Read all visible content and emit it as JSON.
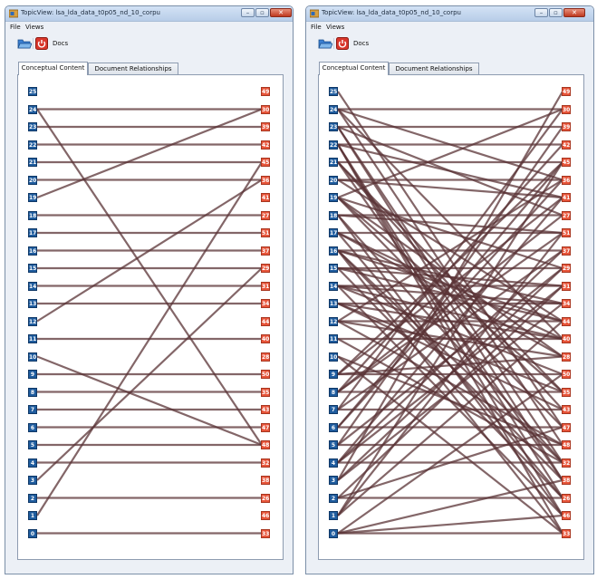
{
  "windows": [
    {
      "title": "TopicView: lsa_lda_data_t0p05_nd_10_corpu",
      "menu": [
        "File",
        "Views"
      ],
      "toolbar": {
        "docs_label": "Docs",
        "open_icon": "folder-open-icon",
        "exit_icon": "power-icon"
      },
      "tabs": [
        {
          "label": "Conceptual Content",
          "active": true
        },
        {
          "label": "Document Relationships",
          "active": false
        }
      ],
      "graph": {
        "topics": [
          "25",
          "24",
          "23",
          "22",
          "21",
          "20",
          "19",
          "18",
          "17",
          "16",
          "15",
          "14",
          "13",
          "12",
          "11",
          "10",
          "9",
          "8",
          "7",
          "6",
          "5",
          "4",
          "3",
          "2",
          "1",
          "0"
        ],
        "documents": [
          "49",
          "30",
          "39",
          "42",
          "45",
          "36",
          "41",
          "27",
          "51",
          "37",
          "29",
          "31",
          "34",
          "44",
          "40",
          "28",
          "50",
          "35",
          "43",
          "47",
          "48",
          "32",
          "38",
          "26",
          "46",
          "33"
        ],
        "edges": [
          [
            "24",
            "30"
          ],
          [
            "24",
            "48"
          ],
          [
            "23",
            "39"
          ],
          [
            "22",
            "42"
          ],
          [
            "21",
            "45"
          ],
          [
            "20",
            "36"
          ],
          [
            "19",
            "30"
          ],
          [
            "18",
            "27"
          ],
          [
            "17",
            "51"
          ],
          [
            "16",
            "37"
          ],
          [
            "15",
            "29"
          ],
          [
            "14",
            "31"
          ],
          [
            "13",
            "34"
          ],
          [
            "12",
            "36"
          ],
          [
            "11",
            "40"
          ],
          [
            "10",
            "48"
          ],
          [
            "9",
            "50"
          ],
          [
            "8",
            "35"
          ],
          [
            "7",
            "43"
          ],
          [
            "6",
            "47"
          ],
          [
            "5",
            "48"
          ],
          [
            "4",
            "32"
          ],
          [
            "3",
            "29"
          ],
          [
            "2",
            "26"
          ],
          [
            "1",
            "45"
          ],
          [
            "0",
            "33"
          ]
        ]
      }
    },
    {
      "title": "TopicView: lsa_lda_data_t0p05_nd_10_corpu",
      "menu": [
        "File",
        "Views"
      ],
      "toolbar": {
        "docs_label": "Docs",
        "open_icon": "folder-open-icon",
        "exit_icon": "power-icon"
      },
      "tabs": [
        {
          "label": "Conceptual Content",
          "active": true
        },
        {
          "label": "Document Relationships",
          "active": false
        }
      ],
      "graph": {
        "topics": [
          "25",
          "24",
          "23",
          "22",
          "21",
          "20",
          "19",
          "18",
          "17",
          "16",
          "15",
          "14",
          "13",
          "12",
          "11",
          "10",
          "9",
          "8",
          "7",
          "6",
          "5",
          "4",
          "3",
          "2",
          "1",
          "0"
        ],
        "documents": [
          "49",
          "30",
          "39",
          "42",
          "45",
          "36",
          "41",
          "27",
          "51",
          "37",
          "29",
          "31",
          "34",
          "44",
          "40",
          "28",
          "50",
          "35",
          "43",
          "47",
          "48",
          "32",
          "38",
          "26",
          "46",
          "33"
        ],
        "edges": [
          [
            "25",
            "47"
          ],
          [
            "24",
            "30"
          ],
          [
            "24",
            "36"
          ],
          [
            "24",
            "40"
          ],
          [
            "24",
            "48"
          ],
          [
            "23",
            "39"
          ],
          [
            "23",
            "27"
          ],
          [
            "23",
            "32"
          ],
          [
            "23",
            "38"
          ],
          [
            "22",
            "42"
          ],
          [
            "22",
            "41"
          ],
          [
            "22",
            "26"
          ],
          [
            "22",
            "46"
          ],
          [
            "22",
            "33"
          ],
          [
            "21",
            "45"
          ],
          [
            "21",
            "35"
          ],
          [
            "21",
            "43"
          ],
          [
            "21",
            "38"
          ],
          [
            "20",
            "36"
          ],
          [
            "20",
            "41"
          ],
          [
            "20",
            "44"
          ],
          [
            "19",
            "30"
          ],
          [
            "19",
            "29"
          ],
          [
            "19",
            "28"
          ],
          [
            "19",
            "35"
          ],
          [
            "19",
            "47"
          ],
          [
            "18",
            "27"
          ],
          [
            "18",
            "51"
          ],
          [
            "18",
            "32"
          ],
          [
            "18",
            "46"
          ],
          [
            "17",
            "51"
          ],
          [
            "17",
            "40"
          ],
          [
            "17",
            "28"
          ],
          [
            "17",
            "26"
          ],
          [
            "16",
            "37"
          ],
          [
            "16",
            "34"
          ],
          [
            "16",
            "44"
          ],
          [
            "16",
            "32"
          ],
          [
            "16",
            "38"
          ],
          [
            "16",
            "33"
          ],
          [
            "15",
            "29"
          ],
          [
            "15",
            "31"
          ],
          [
            "15",
            "44"
          ],
          [
            "15",
            "26"
          ],
          [
            "14",
            "31"
          ],
          [
            "14",
            "34"
          ],
          [
            "14",
            "40"
          ],
          [
            "14",
            "50"
          ],
          [
            "14",
            "46"
          ],
          [
            "13",
            "34"
          ],
          [
            "13",
            "40"
          ],
          [
            "13",
            "35"
          ],
          [
            "13",
            "43"
          ],
          [
            "12",
            "36"
          ],
          [
            "12",
            "44"
          ],
          [
            "12",
            "28"
          ],
          [
            "12",
            "48"
          ],
          [
            "11",
            "40"
          ],
          [
            "11",
            "32"
          ],
          [
            "10",
            "48"
          ],
          [
            "10",
            "33"
          ],
          [
            "9",
            "50"
          ],
          [
            "9",
            "45"
          ],
          [
            "9",
            "41"
          ],
          [
            "9",
            "28"
          ],
          [
            "8",
            "35"
          ],
          [
            "8",
            "42"
          ],
          [
            "8",
            "27"
          ],
          [
            "8",
            "51"
          ],
          [
            "7",
            "43"
          ],
          [
            "7",
            "30"
          ],
          [
            "7",
            "37"
          ],
          [
            "6",
            "47"
          ],
          [
            "6",
            "45"
          ],
          [
            "6",
            "36"
          ],
          [
            "5",
            "48"
          ],
          [
            "5",
            "39"
          ],
          [
            "5",
            "29"
          ],
          [
            "4",
            "32"
          ],
          [
            "4",
            "41"
          ],
          [
            "4",
            "37"
          ],
          [
            "4",
            "31"
          ],
          [
            "3",
            "29"
          ],
          [
            "3",
            "49"
          ],
          [
            "3",
            "34"
          ],
          [
            "2",
            "26"
          ],
          [
            "2",
            "31"
          ],
          [
            "2",
            "47"
          ],
          [
            "1",
            "45"
          ],
          [
            "1",
            "44"
          ],
          [
            "1",
            "51"
          ],
          [
            "0",
            "33"
          ],
          [
            "0",
            "46"
          ],
          [
            "0",
            "50"
          ],
          [
            "0",
            "38"
          ]
        ]
      }
    }
  ],
  "colors": {
    "topic_node": "#1f5c9e",
    "document_node": "#e8553a",
    "edge": "#5a3335"
  }
}
